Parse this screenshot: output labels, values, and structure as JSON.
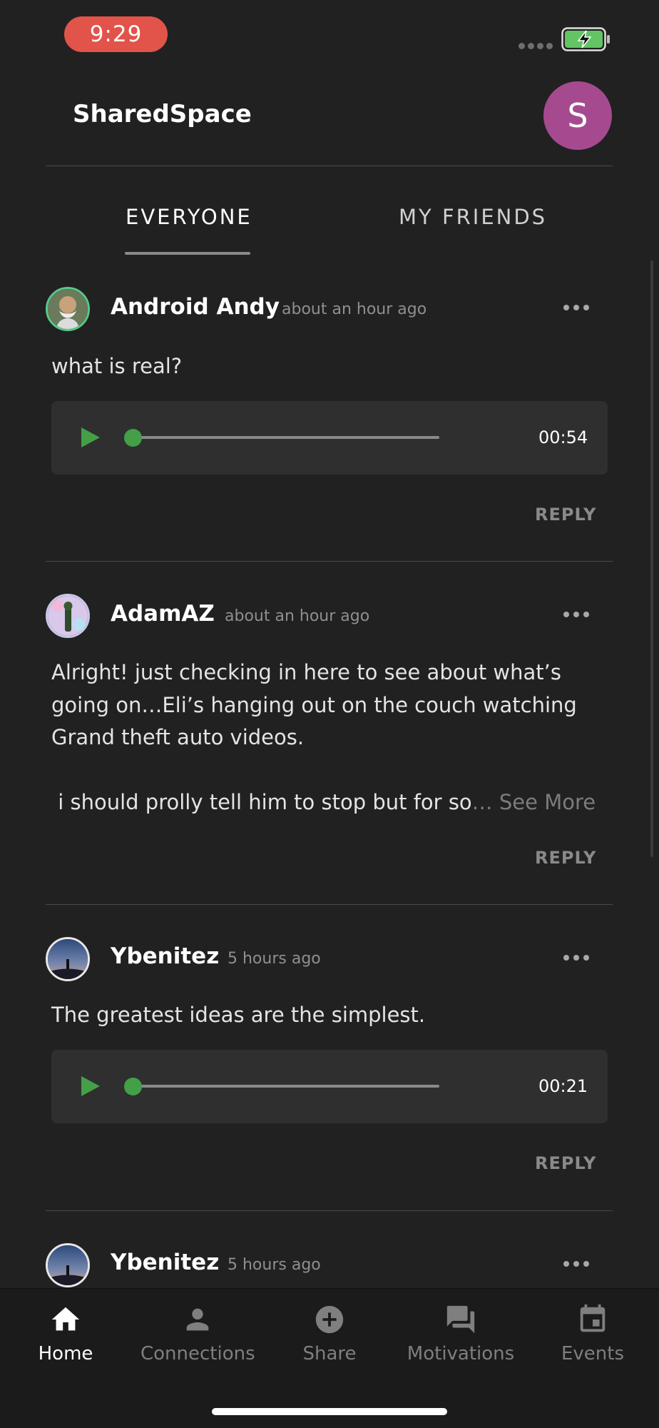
{
  "status_bar": {
    "time": "9:29"
  },
  "header": {
    "title": "SharedSpace",
    "avatar_initial": "S"
  },
  "tabs": [
    {
      "label": "EVERYONE",
      "active": true
    },
    {
      "label": "MY FRIENDS",
      "active": false
    }
  ],
  "posts": [
    {
      "user": "Android Andy",
      "time": "about an hour ago",
      "text": "what is real?",
      "audio": {
        "duration": "00:54",
        "progress": 0
      },
      "reply_label": "REPLY"
    },
    {
      "user": "AdamAZ",
      "time": "about an hour ago",
      "text_lines": [
        "Alright! just checking in here to see about what’s",
        "going on…Eli’s hanging out on the couch watching",
        "Grand theft auto videos.",
        " i should prolly tell him to stop but for so"
      ],
      "see_more": "… See More",
      "reply_label": "REPLY"
    },
    {
      "user": "Ybenitez",
      "time": "5 hours ago",
      "text": "The greatest ideas are the simplest.",
      "audio": {
        "duration": "00:21",
        "progress": 0
      },
      "reply_label": "REPLY"
    },
    {
      "user": "Ybenitez",
      "time": "5 hours ago"
    }
  ],
  "bottom_nav": [
    {
      "label": "Home",
      "icon": "home-icon",
      "active": true
    },
    {
      "label": "Connections",
      "icon": "person-icon",
      "active": false
    },
    {
      "label": "Share",
      "icon": "add-circle-icon",
      "active": false
    },
    {
      "label": "Motivations",
      "icon": "chat-icon",
      "active": false
    },
    {
      "label": "Events",
      "icon": "calendar-icon",
      "active": false
    }
  ],
  "colors": {
    "background": "#212121",
    "accent_green": "#43a047",
    "header_avatar": "#a64a90",
    "time_pill": "#e2534a"
  }
}
